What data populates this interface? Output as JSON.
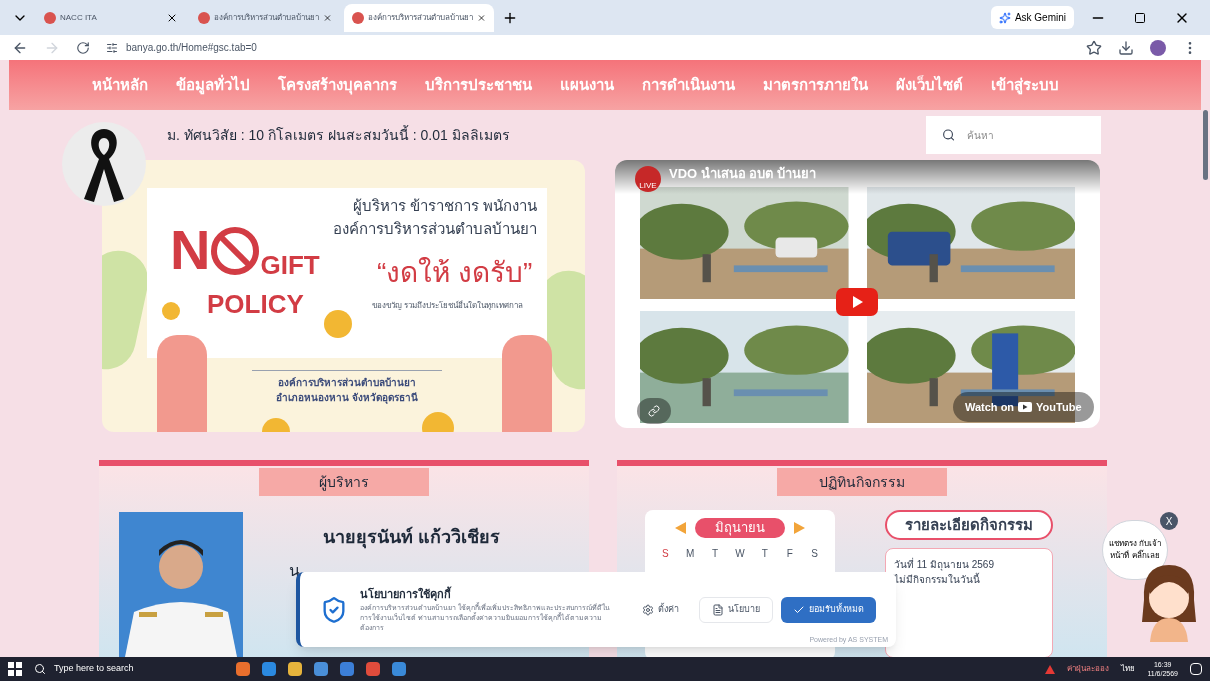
{
  "browser": {
    "tabs": [
      {
        "title": "NACC ITA",
        "selected": false
      },
      {
        "title": "องค์การบริหารส่วนตำบลบ้านยา",
        "selected": false
      },
      {
        "title": "องค์การบริหารส่วนตำบลบ้านยา",
        "selected": true
      }
    ],
    "ask_button": "Ask Gemini",
    "url": "banya.go.th/Home#gsc.tab=0"
  },
  "nav": [
    "หน้าหลัก",
    "ข้อมูลทั่วไป",
    "โครงสร้างบุคลากร",
    "บริการประชาชน",
    "แผนงาน",
    "การดำเนินงาน",
    "มาตรการภายใน",
    "ผังเว็บไซต์",
    "เข้าสู่ระบบ"
  ],
  "ticker": "ม. ทัศนวิสัย : 10 กิโลเมตร ฝนสะสมวันนี้ : 0.01 มิลลิเมตร",
  "search": {
    "placeholder": "ค้นหา"
  },
  "banner": {
    "heading": "ผู้บริหาร ข้าราชการ พนักงาน",
    "org": "องค์การบริหารส่วนตำบลบ้านยา",
    "no": "N",
    "gift": "GIFT",
    "policy": "POLICY",
    "slogan": "“งดให้ งดรับ”",
    "note": "ของขวัญ รวมถึงประโยชน์อื่นใดในทุกเทศกาล",
    "footer_1": "องค์การบริหารส่วนตำบลบ้านยา",
    "footer_2": "อำเภอหนองหาน จังหวัดอุดรธานี"
  },
  "video": {
    "title": "VDO นำเสนอ อบต บ้านยา",
    "channel": "LIVE",
    "watch": "Watch on",
    "brand": "YouTube"
  },
  "executive": {
    "heading": "ผู้บริหาร",
    "name": "นายยุรนันท์ แก้ววิเชียร",
    "position": "น"
  },
  "activities": {
    "heading": "ปฏิทินกิจกรรม",
    "month": "มิถุนายน",
    "weekdays": [
      "S",
      "M",
      "T",
      "W",
      "T",
      "F",
      "S"
    ],
    "detail_title": "รายละเอียดกิจกรรม",
    "date": "วันที่ 11 มิถุนายน 2569",
    "status": "ไม่มีกิจกรรมในวันนี้"
  },
  "cookie": {
    "title": "นโยบายการใช้คุกกี้",
    "body": "องค์การบริหารส่วนตำบลบ้านยา ใช้คุกกี้เพื่อเพิ่มประสิทธิภาพและประสบการณ์ที่ดีในการใช้งานเว็บไซต์ ท่านสามารถเลือกตั้งค่าความยินยอมการใช้คุกกี้ได้ตามความต้องการ",
    "buttons": [
      {
        "label": "ตั้งค่า",
        "kind": "settings"
      },
      {
        "label": "นโยบาย",
        "kind": "policy"
      },
      {
        "label": "ยอมรับทั้งหมด",
        "kind": "accept"
      }
    ],
    "powered": "Powered by AS SYSTEM"
  },
  "chat": {
    "text": "แชทตรง กับเจ้าหน้าที่ คลิ๊กเลย",
    "close": "X"
  },
  "taskbar": {
    "search": "Type here to search",
    "tray_label": "ค่าฝุ่นละออง",
    "language": "ไทย",
    "time": "16:39",
    "date": "11/6/2569"
  }
}
